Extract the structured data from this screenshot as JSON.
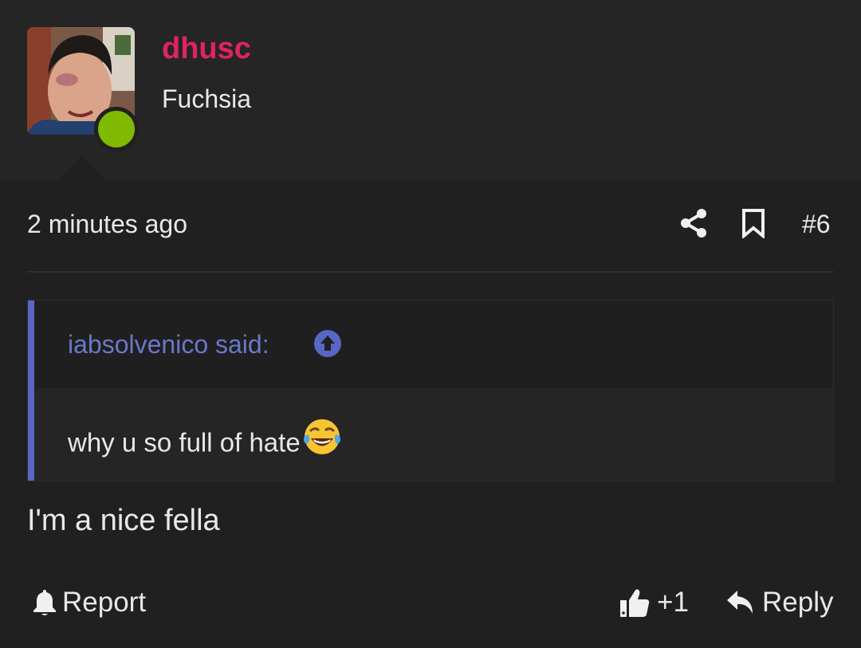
{
  "user": {
    "name": "dhusc",
    "title": "Fuchsia",
    "avatar_alt": "user avatar photo",
    "online": true
  },
  "post": {
    "timestamp": "2 minutes ago",
    "number": "#6",
    "body": "I'm a nice fella"
  },
  "quote": {
    "author_label": "iabsolvenico said:",
    "text": "why u so full of hate"
  },
  "actions": {
    "report_label": "Report",
    "like_count": "+1",
    "reply_label": "Reply"
  },
  "colors": {
    "username": "#e0245e",
    "accent": "#5866c5",
    "online": "#7fba00",
    "background": "#202021"
  },
  "icons": {
    "share": "share-icon",
    "bookmark": "bookmark-icon",
    "quote_up": "arrow-circle-up-icon",
    "emoji": "tears-of-joy-emoji",
    "report": "bell-icon",
    "like": "thumbs-up-icon",
    "reply": "reply-arrow-icon"
  }
}
